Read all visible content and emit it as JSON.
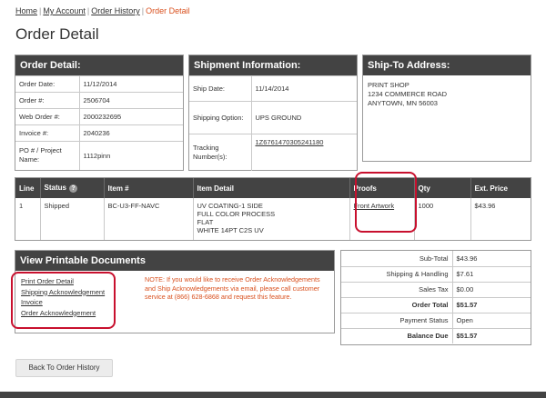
{
  "breadcrumb": {
    "home": "Home",
    "my_account": "My Account",
    "order_history": "Order History",
    "current": "Order Detail",
    "sep": "|"
  },
  "page_title": "Order Detail",
  "order_detail": {
    "heading": "Order Detail:",
    "rows": [
      {
        "label": "Order Date:",
        "value": "11/12/2014"
      },
      {
        "label": "Order #:",
        "value": "2506704"
      },
      {
        "label": "Web Order #:",
        "value": "2000232695"
      },
      {
        "label": "Invoice #:",
        "value": "2040236"
      },
      {
        "label": "PO # / Project Name:",
        "value": "1112pinn"
      }
    ]
  },
  "shipment": {
    "heading": "Shipment Information:",
    "rows": [
      {
        "label": "Ship Date:",
        "value": "11/14/2014"
      },
      {
        "label": "Shipping Option:",
        "value": "UPS GROUND"
      },
      {
        "label": "Tracking Number(s):",
        "value": "1Z6761470305241180"
      }
    ]
  },
  "ship_to": {
    "heading": "Ship-To Address:",
    "lines": [
      "PRINT SHOP",
      "1234 COMMERCE ROAD",
      "ANYTOWN, MN 56003"
    ]
  },
  "items_table": {
    "headers": [
      "Line",
      "Status",
      "Item #",
      "Item Detail",
      "Proofs",
      "Qty",
      "Ext. Price"
    ],
    "help_glyph": "?",
    "row": {
      "line": "1",
      "status": "Shipped",
      "item": "BC-U3-FF-NAVC",
      "detail": [
        "UV COATING-1 SIDE",
        "FULL COLOR PROCESS",
        "FLAT",
        "WHITE 14PT C2S UV"
      ],
      "proof": "Front Artwork",
      "qty": "1000",
      "price": "$43.96"
    }
  },
  "documents": {
    "heading": "View Printable Documents",
    "links": [
      "Print Order Detail",
      "Shipping Acknowledgement",
      "Invoice",
      "Order Acknowledgement"
    ],
    "note": "NOTE: If you would like to receive Order Acknowledgements and Ship Acknowledgements via email, please call customer service at (866) 628-6868 and request this feature."
  },
  "totals": [
    {
      "label": "Sub-Total",
      "value": "$43.96"
    },
    {
      "label": "Shipping & Handling",
      "value": "$7.61"
    },
    {
      "label": "Sales Tax",
      "value": "$0.00"
    },
    {
      "label": "Order Total",
      "value": "$51.57"
    },
    {
      "label": "Payment Status",
      "value": "Open"
    },
    {
      "label": "Balance Due",
      "value": "$51.57"
    }
  ],
  "back_button": "Back To Order History",
  "colors": {
    "header_bg": "#434343",
    "accent": "#d9501e",
    "highlight": "#c8102e"
  }
}
